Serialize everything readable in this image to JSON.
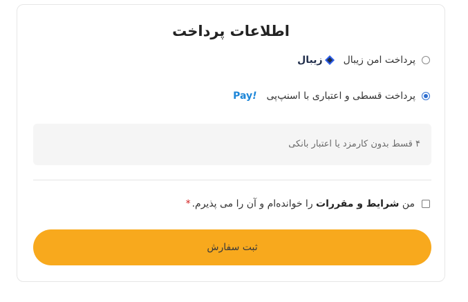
{
  "payment": {
    "title": "اطلاعات پرداخت",
    "options": [
      {
        "label": "پرداخت امن زیبال",
        "logo_text": "زیبال",
        "selected": false
      },
      {
        "label": "پرداخت قسطی و اعتباری با اسنپ‌پی",
        "logo_text": "Pay",
        "logo_suffix": "!",
        "selected": true
      }
    ],
    "info_text": "۴ قسط بدون کارمزد یا اعتبار بانکی"
  },
  "terms": {
    "prefix": "من ",
    "bold": "شرایط و مقررات",
    "suffix": " را خوانده‌ام و آن را می پذیرم.",
    "required_mark": "*",
    "checked": false
  },
  "submit": {
    "label": "ثبت سفارش"
  },
  "colors": {
    "accent": "#f8a91d",
    "radio_selected": "#2f6fd0",
    "snapp_blue": "#1d86d8",
    "zibal_navy": "#1f2d4a",
    "zibal_blue": "#2b5ce6",
    "required": "#d21e1e"
  },
  "icons": {
    "zibal": "zibal-logo-icon",
    "snapp": "snapp-pay-logo-icon"
  }
}
